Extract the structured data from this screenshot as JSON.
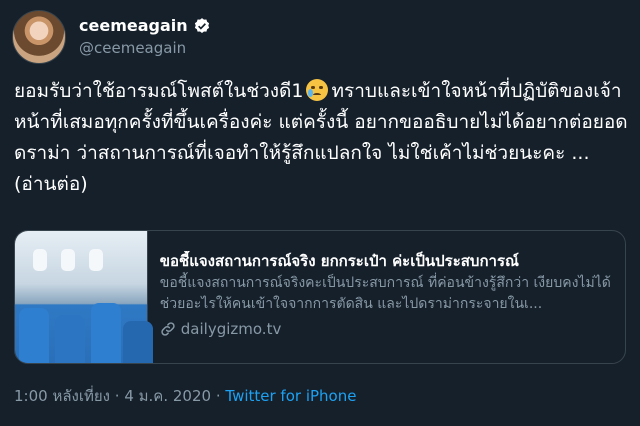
{
  "author": {
    "display_name": "ceemeagain",
    "handle": "@ceemeagain",
    "verified": true,
    "avatar_icon": "profile-photo"
  },
  "tweet": {
    "line1_before_emoji": "ยอมรับว่าใช้อารมณ์โพสต์ในช่วงดี1",
    "emoji_name": "crying-face-emoji",
    "line1_after_emoji": "ทราบและเข้าใจหน้าที่ปฏิบัติของเจ้าหน้าที่เสมอทุกครั้งที่ขึ้นเครื่องค่ะ แต่ครั้งนี้ อยากขออธิบายไม่ได้อยากต่อยอดดราม่า ว่าสถานการณ์ที่เจอทำให้รู้สึกแปลกใจ ไม่ใช่เค้าไม่ช่วยนะคะ ...(อ่านต่อ)"
  },
  "link_card": {
    "title": "ขอชี้แจงสถานการณ์จริง ยกกระเป๋า ค่ะเป็นประสบการณ์",
    "description": "ขอชี้แจงสถานการณ์จริงคะเป็นประสบการณ์ ที่ค่อนข้างรู้สึกว่า เงียบคงไม่ได้ช่วยอะไรให้คนเข้าใจจากการตัดสิน และไปดราม่ากระจายในเ...",
    "domain": "dailygizmo.tv",
    "thumbnail": "airplane-cabin-seats"
  },
  "meta": {
    "time": "1:00 หลังเที่ยง",
    "separator": "·",
    "date": "4 ม.ค. 2020",
    "source": "Twitter for iPhone"
  },
  "colors": {
    "background": "#15202b",
    "text": "#ffffff",
    "secondary": "#8899a6",
    "accent": "#1da1f2",
    "border": "#38444d"
  }
}
